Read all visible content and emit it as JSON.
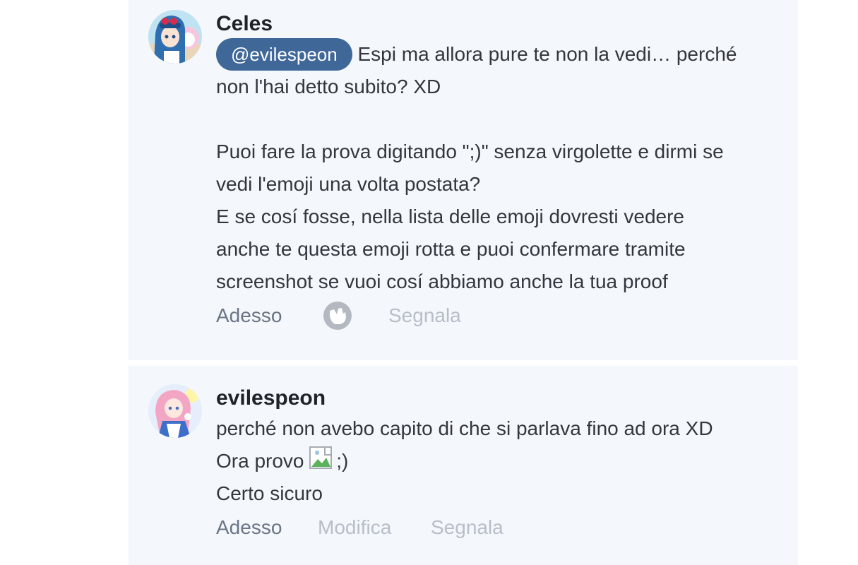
{
  "comments": [
    {
      "author": "Celes",
      "mention": "@evilespeon",
      "lines": [
        "Espi ma allora pure te non la vedi… perché",
        "non l'hai detto subito? XD",
        "",
        "Puoi fare la prova digitando \";)\" senza virgolette e dirmi se",
        "vedi l'emoji una volta postata?",
        "E se cosí fosse, nella lista delle emoji dovresti vedere",
        "anche te questa emoji rotta e puoi confermare tramite",
        "screenshot se vuoi cosí abbiamo anche la tua proof"
      ],
      "time": "Adesso",
      "react_icon": "reaction-hand-icon",
      "report": "Segnala"
    },
    {
      "author": "evilespeon",
      "lines": [
        "perché non avebo capito di che si parlava fino ad ora XD",
        "Ora provo",
        ";)",
        "Certo sicuro"
      ],
      "broken_image_icon": "broken-image-icon",
      "time": "Adesso",
      "edit": "Modifica",
      "report": "Segnala"
    }
  ],
  "colors": {
    "card_bg": "#f4f7fb",
    "mention_bg": "#3f6899",
    "muted_action": "#b8bec8",
    "time_text": "#6b7585"
  }
}
